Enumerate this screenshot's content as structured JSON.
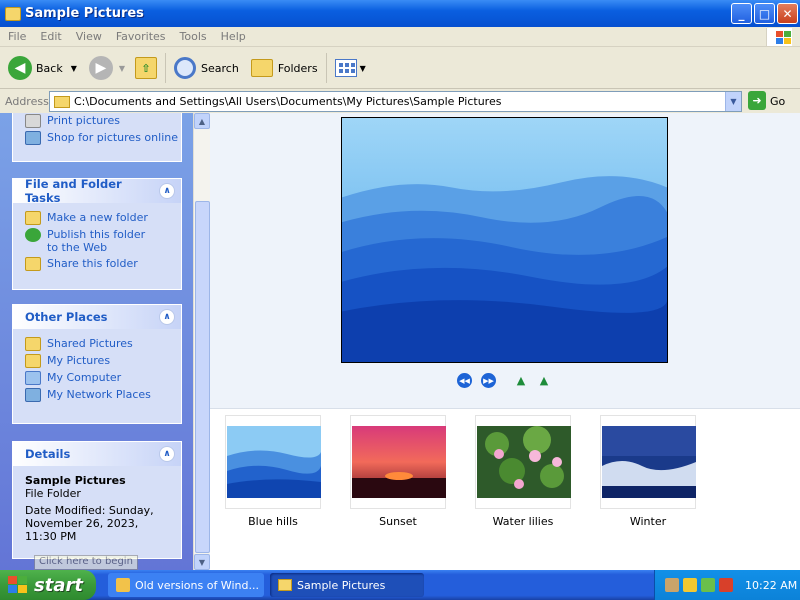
{
  "window": {
    "title": "Sample Pictures",
    "controls": {
      "minimize": "_",
      "maximize": "□",
      "close": "✕"
    }
  },
  "menu": [
    "File",
    "Edit",
    "View",
    "Favorites",
    "Tools",
    "Help"
  ],
  "toolbar": {
    "back": "Back",
    "search": "Search",
    "folders": "Folders"
  },
  "address": {
    "label": "Address",
    "path": "C:\\Documents and Settings\\All Users\\Documents\\My Pictures\\Sample Pictures",
    "go": "Go"
  },
  "picture_tasks": {
    "items": [
      "Print pictures",
      "Shop for pictures online"
    ]
  },
  "file_folder_tasks": {
    "title": "File and Folder Tasks",
    "items": [
      "Make a new folder",
      "Publish this folder to the Web",
      "Share this folder"
    ]
  },
  "other_places": {
    "title": "Other Places",
    "items": [
      "Shared Pictures",
      "My Pictures",
      "My Computer",
      "My Network Places"
    ]
  },
  "details": {
    "title": "Details",
    "name": "Sample Pictures",
    "type": "File Folder",
    "modified": "Date Modified: Sunday, November 26, 2023, 11:30 PM"
  },
  "tooltip": "Click here to begin",
  "thumbnails": [
    "Blue hills",
    "Sunset",
    "Water lilies",
    "Winter"
  ],
  "taskbar": {
    "start": "start",
    "tasks": [
      "Old versions of Wind...",
      "Sample Pictures"
    ],
    "clock": "10:22 AM"
  },
  "colors": {
    "link": "#215dc6",
    "taskpane_top": "#7ba2e7",
    "taskbar": "#245edb",
    "start_green": "#3a9a3a"
  }
}
